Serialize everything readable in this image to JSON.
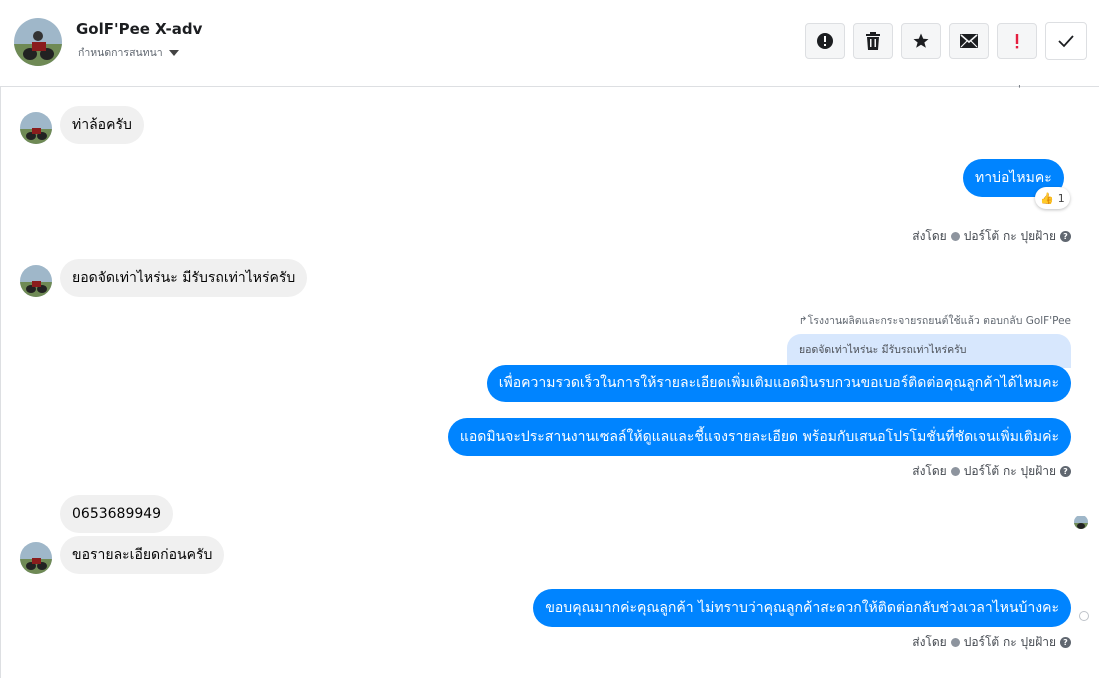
{
  "header": {
    "name": "GolF'Pee X-adv",
    "subtitle": "กำหนดการสนทนา",
    "actions": [
      {
        "icon": "alert-circle-icon",
        "name": "report-button"
      },
      {
        "icon": "trash-icon",
        "name": "delete-button"
      },
      {
        "icon": "star-icon",
        "name": "star-button"
      },
      {
        "icon": "envelope-icon",
        "name": "mark-unread-button"
      },
      {
        "icon": "exclamation-icon",
        "name": "important-button"
      },
      {
        "icon": "check-icon",
        "name": "done-button"
      }
    ]
  },
  "colors": {
    "accent": "#0084ff",
    "incoming": "#f0f0f0",
    "important": "#e41e3f"
  },
  "messages": {
    "m1": "ท่าล้อครับ",
    "m2": "ทาบ่อไหมคะ",
    "m2_reaction": "👍",
    "m2_reaction_count": "1",
    "sent_by_1": "ส่งโดย",
    "sender_1": "ปอร์โต้ กะ ปุยฝ้าย",
    "m3": "ยอดจัดเท่าไหร่นะ มีรับรถเท่าไหร่ครับ",
    "reply_note": "↱โรงงานผลิตและกระจายรถยนต์ใช้แล้ว ตอบกลับ GolF'Pee",
    "reply_quote": "ยอดจัดเท่าไหร่นะ มีรับรถเท่าไหร่ครับ",
    "m4": "เพื่อความรวดเร็วในการให้รายละเอียดเพิ่มเติมแอดมินรบกวนขอเบอร์ติดต่อคุณลูกค้าได้ไหมคะ",
    "m5": "แอดมินจะประสานงานเซลล์ให้ดูแลและชี้แจงรายละเอียด พร้อมกับเสนอโปรโมชั่นที่ชัดเจนเพิ่มเติมค่ะ",
    "sent_by_2": "ส่งโดย",
    "sender_2": "ปอร์โต้ กะ ปุยฝ้าย",
    "m6": "0653689949",
    "m7": "ขอรายละเอียดก่อนครับ",
    "m8": "ขอบคุณมากค่ะคุณลูกค้า ไม่ทราบว่าคุณลูกค้าสะดวกให้ติดต่อกลับช่วงเวลาไหนบ้างคะ",
    "sent_by_3": "ส่งโดย",
    "sender_3": "ปอร์โต้ กะ ปุยฝ้าย"
  }
}
